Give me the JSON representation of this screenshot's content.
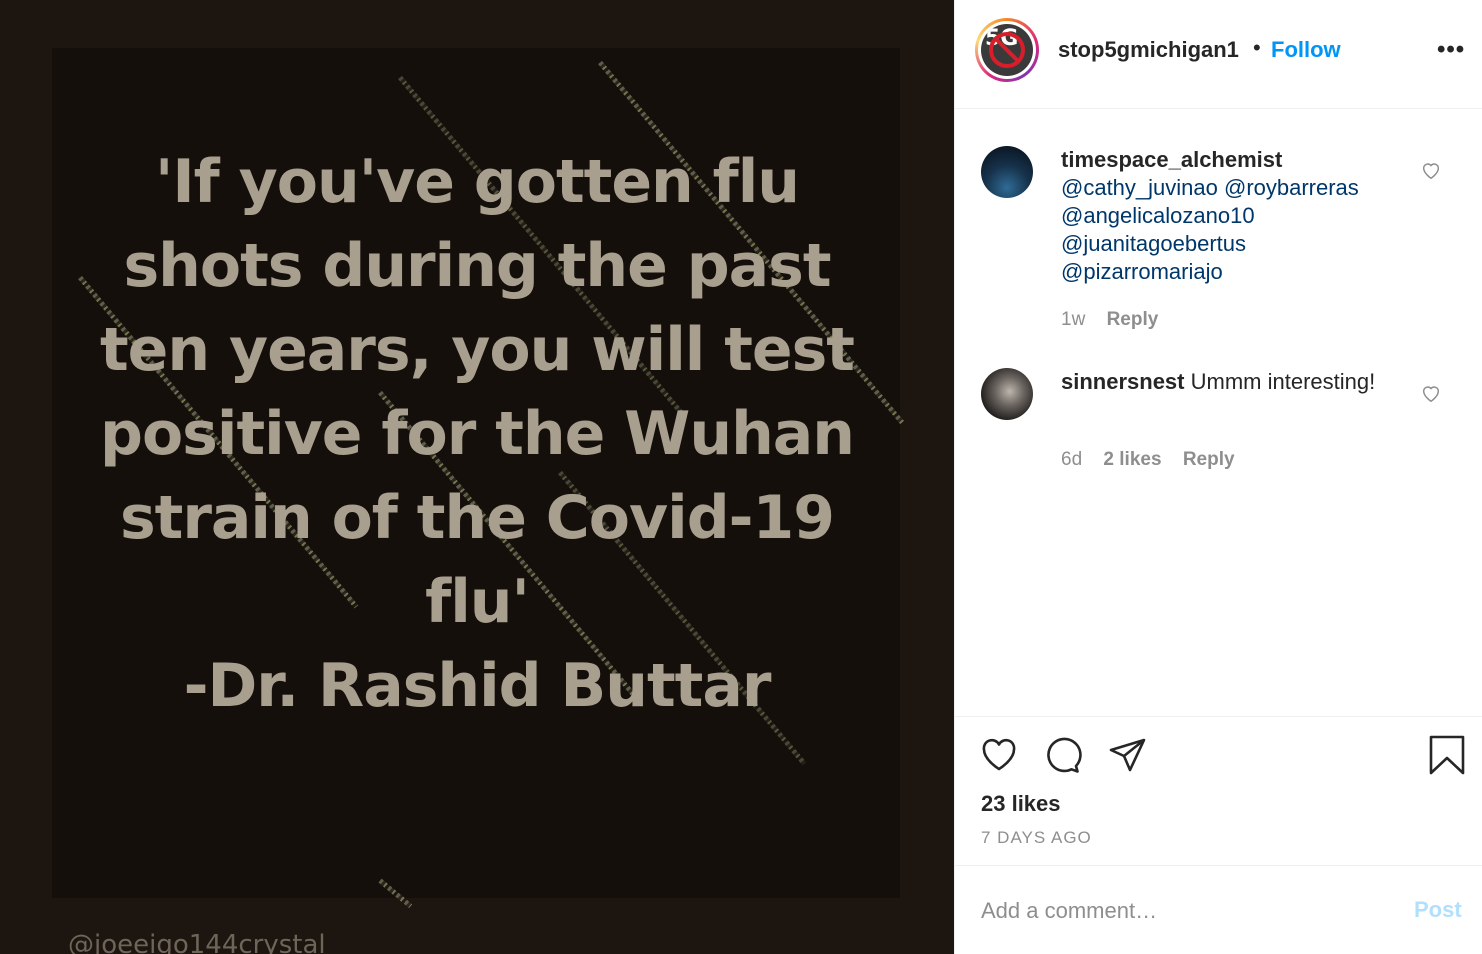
{
  "post": {
    "quote_lines": [
      "'If you've gotten flu",
      "shots during the past",
      "ten years, you will test",
      "positive for the Wuhan",
      "strain of the Covid-19",
      "flu'",
      "-Dr. Rashid Buttar"
    ],
    "watermark": "@joeeigo144crystal"
  },
  "header": {
    "username": "stop5gmichigan1",
    "separator": "•",
    "follow_label": "Follow",
    "more_label": "•••"
  },
  "comments": [
    {
      "user": "timespace_alchemist",
      "text": "",
      "mentions": [
        "@cathy_juvinao @roybarreras",
        "@angelicalozano10",
        "@juanitagoebertus",
        "@pizarromariajo"
      ],
      "age": "1w",
      "likes": "",
      "reply_label": "Reply"
    },
    {
      "user": "sinnersnest",
      "text": "Ummm interesting!",
      "mentions": [],
      "age": "6d",
      "likes": "2 likes",
      "reply_label": "Reply"
    }
  ],
  "actions": {
    "likes_count": "23 likes",
    "time_ago": "7 DAYS AGO"
  },
  "add_comment": {
    "placeholder": "Add a comment…",
    "post_label": "Post"
  },
  "colors": {
    "link_blue": "#0095f6",
    "mention_blue": "#00376b",
    "muted": "#8e8e8e",
    "post_disabled": "#b2dffc",
    "quote_text": "#a89f8e",
    "media_bg": "#1c1510"
  },
  "icons": [
    "heart-icon",
    "comment-icon",
    "share-icon",
    "bookmark-icon",
    "more-icon"
  ]
}
